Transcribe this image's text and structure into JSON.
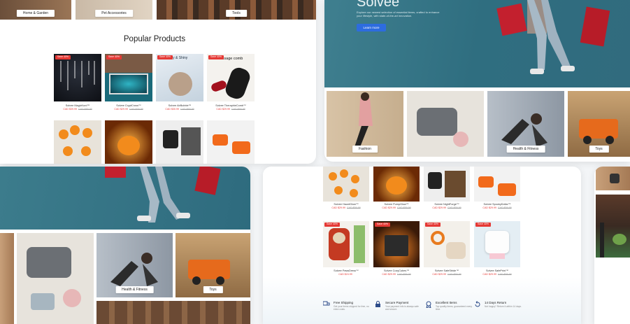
{
  "panel1": {
    "cat_home_garden": "Home & Garden",
    "cat_pet": "Pet Accessories",
    "cat_tools": "Tools",
    "section_title": "Popular Products",
    "products": [
      {
        "name": "Solvee MagicKurd™",
        "price": "CAD $39.99",
        "old": "CAD $89.99",
        "sale": "Save 40%"
      },
      {
        "name": "Solvee CryptCross™",
        "price": "CAD $29.99",
        "old": "CAD $39.99",
        "sale": "Save 40%"
      },
      {
        "name": "Solvee AirBubble™",
        "price": "CAD $30.99",
        "old": "CAD $69.99",
        "sale": "Save 40%"
      },
      {
        "name": "Solvee TheraphieComb™",
        "price": "CAD $29.99",
        "old": "CAD $59.99",
        "sale": "Save 40%"
      }
    ],
    "ad_text_1": "Constantly & Shiny",
    "ad_text_2": "massage comb"
  },
  "panel2": {
    "brand": "Solvee",
    "tagline": "Explore our newest selection of essential items, crafted to enhance your lifestyle, with state-of-the-art innovation.",
    "cta": "Learn more",
    "tiles": [
      {
        "label": "Fashion"
      },
      {
        "label": ""
      },
      {
        "label": "Health & Fitness"
      },
      {
        "label": "Toys"
      }
    ]
  },
  "panel3": {
    "tiles": [
      {
        "label": "Health & Fitness"
      },
      {
        "label": "Toys"
      }
    ]
  },
  "panel4": {
    "row1": [
      {
        "name": "Solvee HauntGlow™",
        "price": "CAD $29.99",
        "old": "CAD $59.99"
      },
      {
        "name": "Solvee PumpGlow™",
        "price": "CAD $29.99",
        "old": "CAD $59.99"
      },
      {
        "name": "Solvee NightForge™",
        "price": "CAD $29.99",
        "old": "CAD $59.99"
      },
      {
        "name": "Solvee SpookyDollar™",
        "price": "CAD $29.99",
        "old": "CAD $59.99"
      }
    ],
    "row2": [
      {
        "name": "Solvee PawsDress™",
        "price": "CAD $24.99",
        "old": "",
        "sale": "Save 40%"
      },
      {
        "name": "Solvee CozyCubes™",
        "price": "CAD $29.99",
        "old": "CAD $59.99",
        "sale": "Save 40%"
      },
      {
        "name": "Solvee SafeStride™",
        "price": "CAD $29.99",
        "old": "CAD $59.99",
        "sale": "Save 40%"
      },
      {
        "name": "Solvee SafePrint™",
        "price": "CAD $29.99",
        "old": "CAD $59.99",
        "sale": "Save 40%"
      }
    ],
    "features": [
      {
        "title": "Free Shipping",
        "sub": "Get your items shipped for free, no extra costs."
      },
      {
        "title": "Secure Payment",
        "sub": "Your payment info is always safe and secure."
      },
      {
        "title": "Excellent Items",
        "sub": "Top quality items, guaranteed every time."
      },
      {
        "title": "14 Days Return",
        "sub": "Not happy? Return it within 14 days."
      }
    ]
  }
}
